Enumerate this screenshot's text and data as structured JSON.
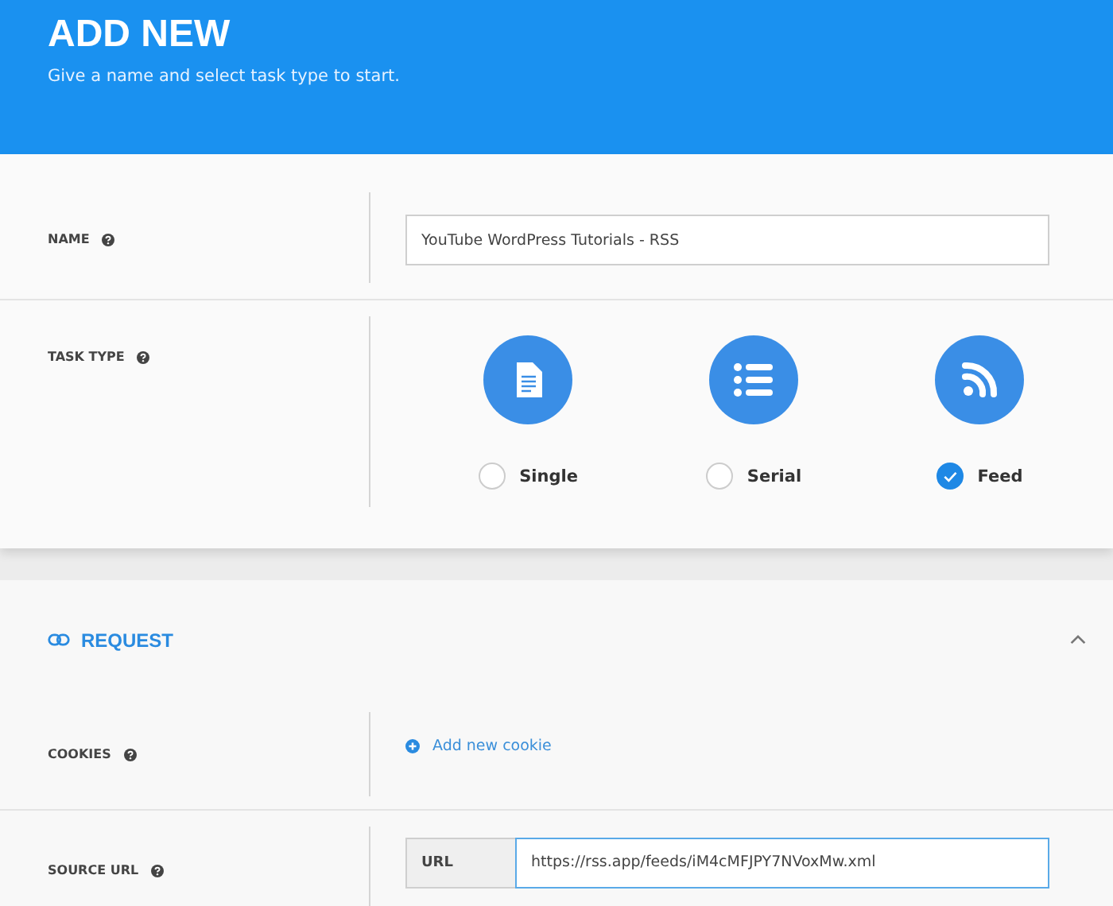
{
  "header": {
    "title": "ADD NEW",
    "subtitle": "Give a name and select task type to start."
  },
  "name": {
    "label": "NAME",
    "value": "YouTube WordPress Tutorials - RSS"
  },
  "task_type": {
    "label": "TASK TYPE",
    "options": [
      {
        "label": "Single",
        "kind": "document",
        "selected": false
      },
      {
        "label": "Serial",
        "kind": "list",
        "selected": false
      },
      {
        "label": "Feed",
        "kind": "rss",
        "selected": true
      }
    ]
  },
  "request": {
    "title": "REQUEST",
    "expanded": true,
    "cookies": {
      "label": "COOKIES",
      "link": "Add new cookie"
    },
    "source_url": {
      "label": "SOURCE URL",
      "addon": "URL",
      "value": "https://rss.app/feeds/iM4cMFJPY7NVoxMw.xml"
    }
  }
}
